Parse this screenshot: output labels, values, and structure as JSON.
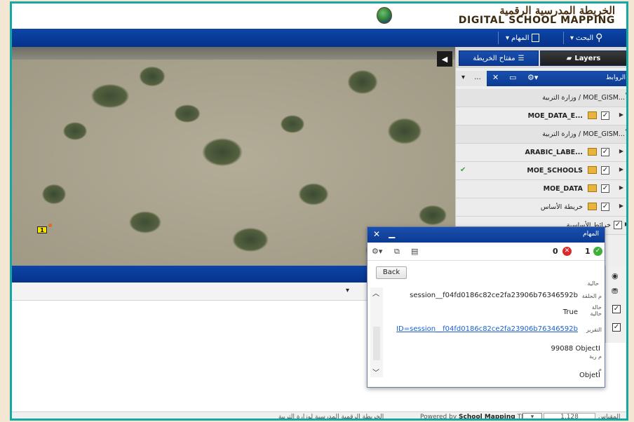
{
  "header": {
    "logo_ar": "الخريطة المدرسية الرقمية",
    "logo_en": "DIGITAL SCHOOL MAPPING"
  },
  "toolbar": {
    "search_label": "البحث",
    "tasks_label": "المهام"
  },
  "panel": {
    "tab_layers": "Layers",
    "tab_legend": "مفتاح الخريطة",
    "layers_header_title": "الروابط",
    "dd_label": "...",
    "rows": [
      {
        "text": "وزارة التربية / MOE_GISM...",
        "type": "group"
      },
      {
        "text": "MOE_DATA_E...",
        "type": "layer"
      },
      {
        "text": "وزارة التربية / MOE_GISM...",
        "type": "group"
      },
      {
        "text": "ARABIC_LABE...",
        "type": "layer"
      },
      {
        "text": "MOE_SCHOOLS",
        "type": "layer"
      },
      {
        "text": "MOE_DATA",
        "type": "layer"
      },
      {
        "text": "خريطة الأساس",
        "type": "layer"
      },
      {
        "text": "خرائط الأساسية",
        "type": "layer"
      }
    ]
  },
  "map": {
    "marker_label": "1"
  },
  "dialog": {
    "title": "المهام",
    "error_count": "0",
    "success_count": "1",
    "back_label": "Back",
    "fields": [
      {
        "label": "حالية",
        "value": ""
      },
      {
        "label": "م الحلقة",
        "value": "session__f04fd0186c82ce2fa23906b76346592b"
      },
      {
        "label": "حالة حالية",
        "value": "True"
      },
      {
        "label": "التقرير",
        "value": "ID=session__f04fd0186c82ce2fa23906b76346592b",
        "link": true
      },
      {
        "label": "م رية",
        "value": "99088 ObjectI"
      },
      {
        "label": "م",
        "value": "ObjetI"
      }
    ]
  },
  "status": {
    "left_text": "الخريطة الرقمية المدرسية لوزارة التربية",
    "powered_prefix": "Powered by ",
    "powered_brand": "School Mapping",
    "powered_tm": " TM",
    "scale_label": "المقياس 1:",
    "scale_value": "1,128"
  }
}
